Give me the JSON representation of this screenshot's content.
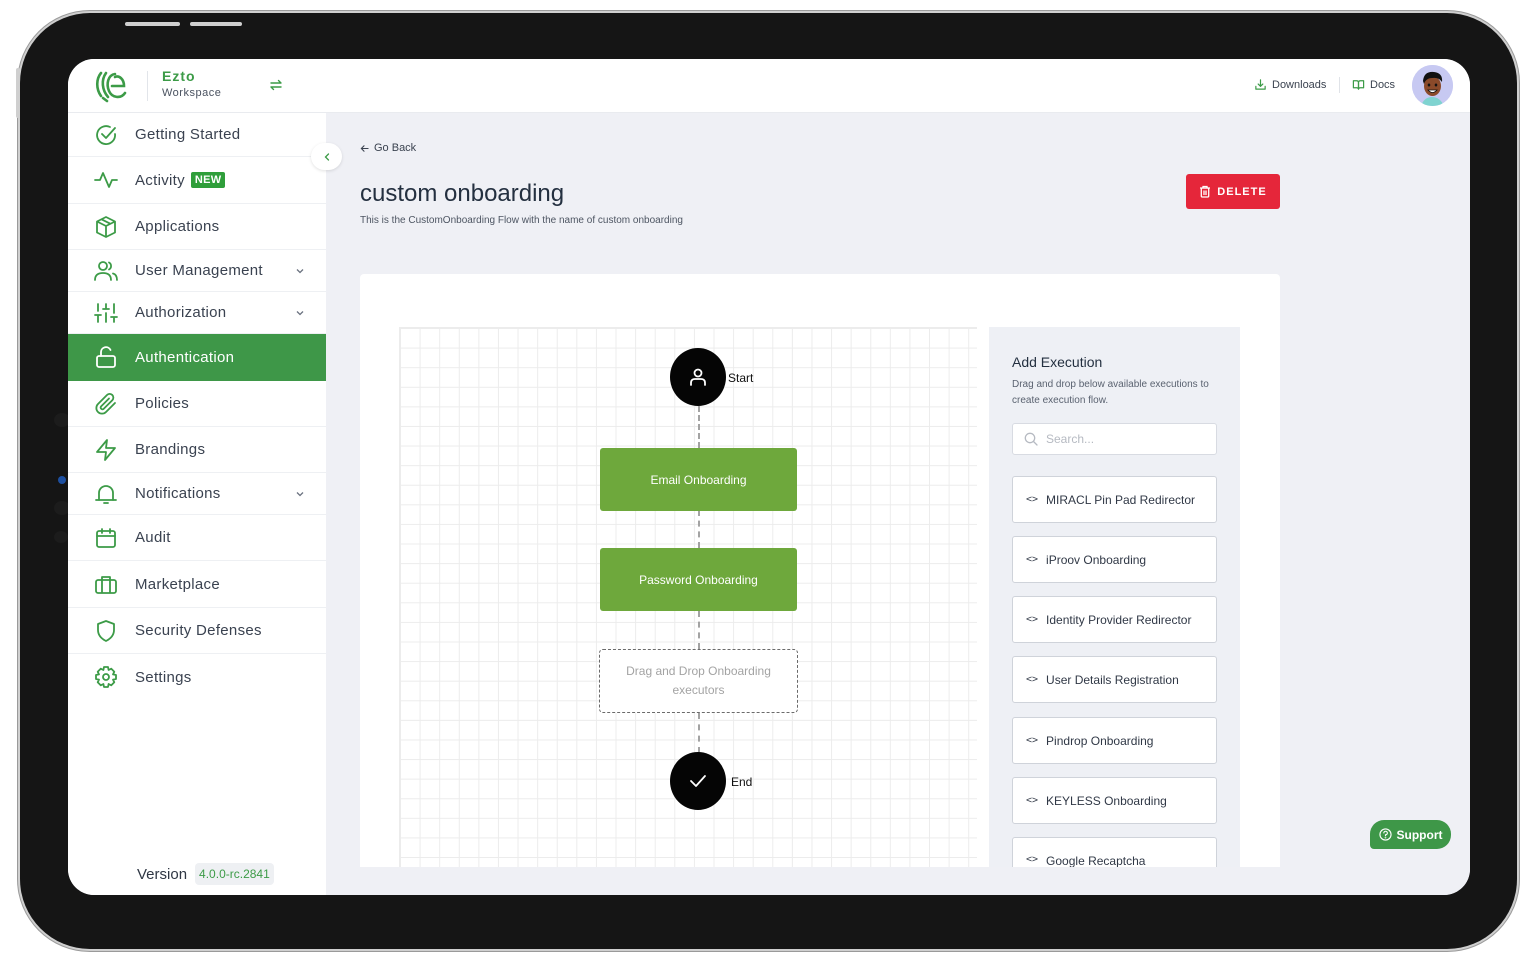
{
  "app": {
    "brand_name": "Ezto",
    "brand_sub": "Workspace",
    "accent_color": "#3e9748"
  },
  "header": {
    "downloads_label": "Downloads",
    "docs_label": "Docs"
  },
  "sidebar": {
    "items": [
      {
        "label": "Getting Started",
        "icon": "check-circle-icon"
      },
      {
        "label": "Activity",
        "icon": "activity-icon",
        "badge": "NEW"
      },
      {
        "label": "Applications",
        "icon": "box-icon"
      },
      {
        "label": "User Management",
        "icon": "users-icon",
        "expandable": true
      },
      {
        "label": "Authorization",
        "icon": "sliders-icon",
        "expandable": true
      },
      {
        "label": "Authentication",
        "icon": "unlock-icon",
        "active": true
      },
      {
        "label": "Policies",
        "icon": "paperclip-icon"
      },
      {
        "label": "Brandings",
        "icon": "zap-icon"
      },
      {
        "label": "Notifications",
        "icon": "bell-icon",
        "expandable": true
      },
      {
        "label": "Audit",
        "icon": "calendar-icon"
      },
      {
        "label": "Marketplace",
        "icon": "briefcase-icon"
      },
      {
        "label": "Security Defenses",
        "icon": "shield-icon"
      },
      {
        "label": "Settings",
        "icon": "gear-icon"
      }
    ],
    "version_label": "Version",
    "version_value": "4.0.0-rc.2841"
  },
  "main": {
    "go_back_label": "Go Back",
    "title": "custom onboarding",
    "subtitle": "This is the CustomOnboarding Flow with the name of custom onboarding",
    "delete_label": "DELETE"
  },
  "flow": {
    "start_label": "Start",
    "end_label": "End",
    "steps": [
      "Email Onboarding",
      "Password Onboarding"
    ],
    "drop_placeholder": "Drag and Drop Onboarding executors"
  },
  "executions": {
    "title": "Add Execution",
    "description": "Drag and drop below available executions to create execution flow.",
    "search_placeholder": "Search...",
    "items": [
      "MIRACL Pin Pad Redirector",
      "iProov Onboarding",
      "Identity Provider Redirector",
      "User Details Registration",
      "Pindrop Onboarding",
      "KEYLESS Onboarding",
      "Google Recaptcha"
    ]
  },
  "support_label": "Support"
}
